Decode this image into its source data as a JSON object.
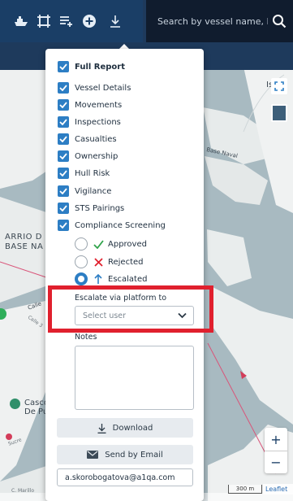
{
  "search": {
    "placeholder": "Search by vessel name, IMO"
  },
  "toolbar": {
    "icons": [
      "ship-icon",
      "crop-icon",
      "list-add-icon",
      "plus-circle-icon",
      "download-icon"
    ]
  },
  "map": {
    "labels": {
      "barrio": "ARRIO D\nBASE NA",
      "base_naval": "Base Naval",
      "calle": "Calle",
      "calle2": "Calle 3",
      "is": "Is",
      "casco": "Casco\nDe Pu",
      "sucre": "Sucre",
      "marillo": "C. Marillo"
    },
    "scale_label": "300 m",
    "attribution": "Leaflet",
    "zoom_in": "+",
    "zoom_out": "−"
  },
  "panel": {
    "full_report": "Full Report",
    "sections": [
      "Vessel Details",
      "Movements",
      "Inspections",
      "Casualties",
      "Ownership",
      "Hull Risk",
      "Vigilance",
      "STS Pairings",
      "Compliance Screening"
    ],
    "screening_options": [
      {
        "label": "Approved",
        "selected": false,
        "icon": "check-icon",
        "color": "#2fa34a"
      },
      {
        "label": "Rejected",
        "selected": false,
        "icon": "x-icon",
        "color": "#e0202e"
      },
      {
        "label": "Escalated",
        "selected": true,
        "icon": "arrow-up-icon",
        "color": "#2d7ec4"
      }
    ],
    "escalate_label": "Escalate via platform to",
    "select_placeholder": "Select user",
    "notes_label": "Notes",
    "notes_value": "",
    "download_label": "Download",
    "email_button_label": "Send by Email",
    "email_value": "a.skorobogatova@a1qa.com"
  },
  "colors": {
    "accent": "#2d7ec4",
    "toolbar_bg": "#1a3e66",
    "search_bg": "#101c2e",
    "highlight": "#e0202e"
  }
}
